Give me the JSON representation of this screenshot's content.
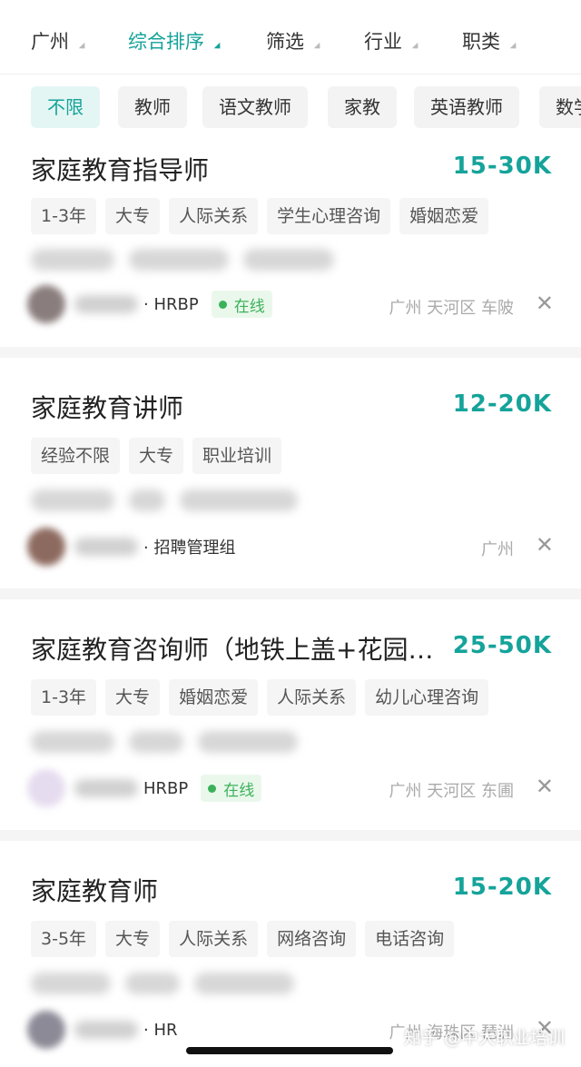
{
  "filters": [
    {
      "label": "广州",
      "active": false
    },
    {
      "label": "综合排序",
      "active": true
    },
    {
      "label": "筛选",
      "active": false
    },
    {
      "label": "行业",
      "active": false
    },
    {
      "label": "职类",
      "active": false
    }
  ],
  "chips": [
    "不限",
    "教师",
    "语文教师",
    "家教",
    "英语教师",
    "数学"
  ],
  "jobs": [
    {
      "title": "家庭教育指导师",
      "salary": "15-30K",
      "tags": [
        "1-3年",
        "大专",
        "人际关系",
        "学生心理咨询",
        "婚姻恋爱"
      ],
      "role": "· HRBP",
      "online": "在线",
      "location": "广州  天河区  车陂"
    },
    {
      "title": "家庭教育讲师",
      "salary": "12-20K",
      "tags": [
        "经验不限",
        "大专",
        "职业培训"
      ],
      "role": "· 招聘管理组",
      "online": "",
      "location": "广州"
    },
    {
      "title": "家庭教育咨询师（地铁上盖+花园…",
      "salary": "25-50K",
      "tags": [
        "1-3年",
        "大专",
        "婚姻恋爱",
        "人际关系",
        "幼儿心理咨询"
      ],
      "role": "HRBP",
      "online": "在线",
      "location": "广州  天河区  东圃"
    },
    {
      "title": "家庭教育师",
      "salary": "15-20K",
      "tags": [
        "3-5年",
        "大专",
        "人际关系",
        "网络咨询",
        "电话咨询"
      ],
      "role": "· HR",
      "online": "",
      "location": "广州  海珠区  琶洲"
    }
  ],
  "close_icon": "close-icon",
  "watermark": "知乎 @中大职业培训",
  "colors": {
    "accent": "#15a39a",
    "online": "#3cb15a"
  }
}
